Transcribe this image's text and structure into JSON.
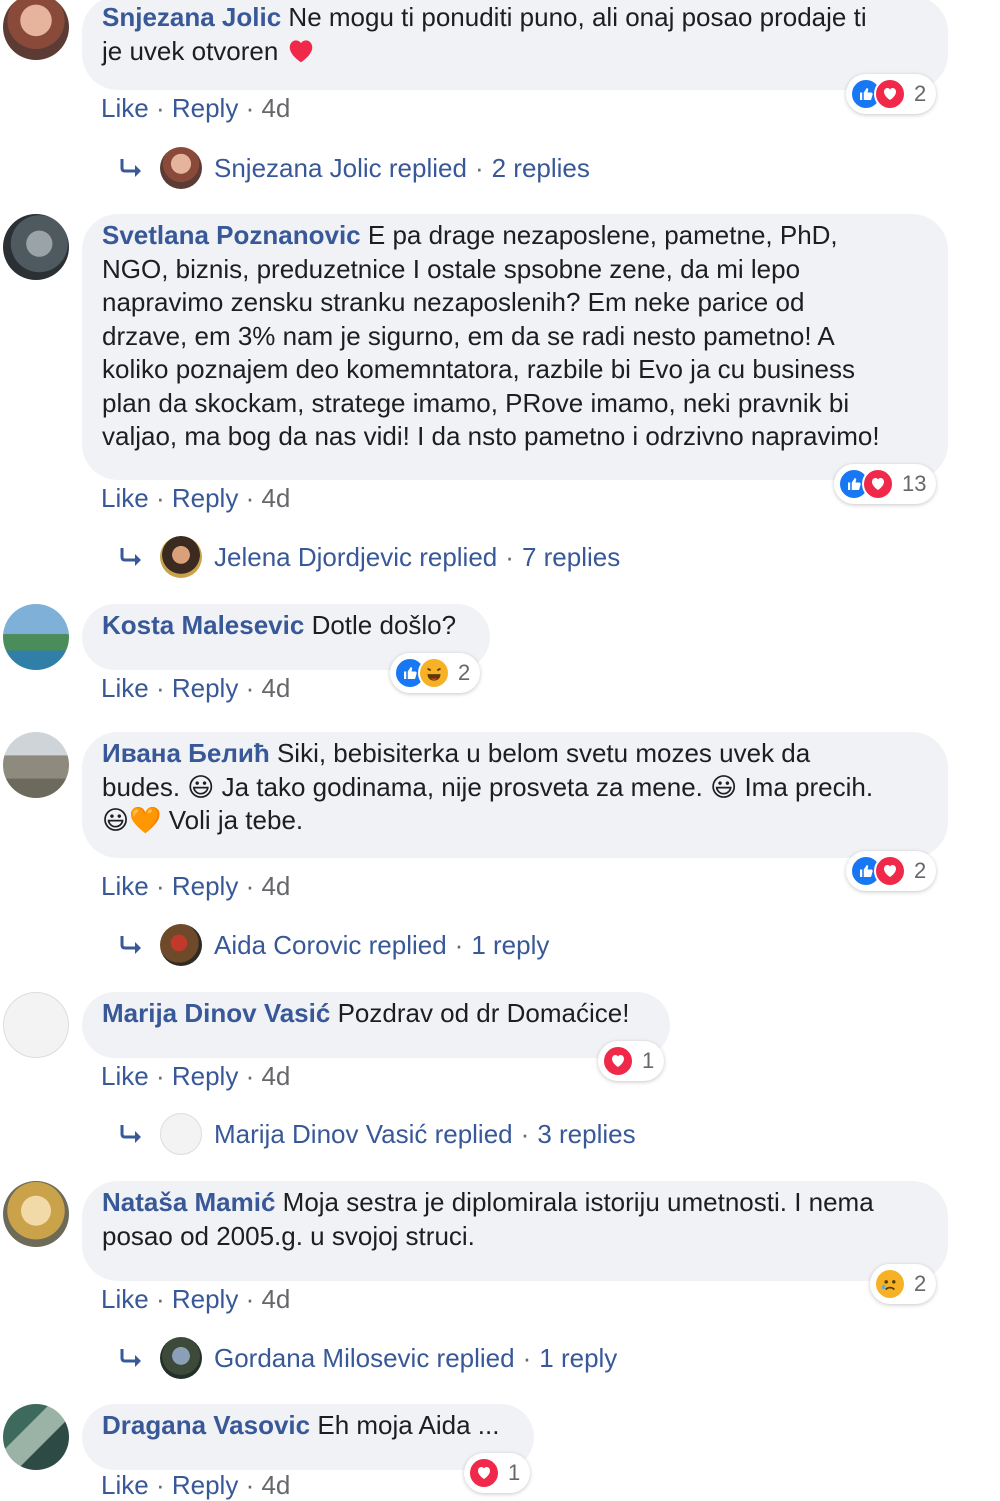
{
  "comments": [
    {
      "author": "Snjezana Jolic",
      "text_lines": [
        "Ne mogu ti ponuditi puno, ali onaj posao prodaje ti",
        "je uvek otvoren"
      ],
      "like_label": "Like",
      "reply_label": "Reply",
      "time": "4d",
      "reactions": [
        "like",
        "love"
      ],
      "reaction_count": "2",
      "thread": {
        "replier": "Snjezana Jolic replied",
        "count": "2 replies"
      }
    },
    {
      "author": "Svetlana Poznanovic",
      "text_lines": [
        "E pa drage nezaposlene, pametne, PhD,",
        "NGO, biznis, preduzetnice I ostale spsobne zene, da mi lepo",
        "napravimo zensku stranku nezaposlenih? Em neke parice od",
        "drzave, em 3% nam je sigurno, em da se radi nesto pametno! A",
        "koliko poznajem deo komemntatora, razbile bi Evo ja cu business",
        "plan da skockam, stratege imamo, PRove imamo, neki pravnik bi",
        "valjao, ma bog da nas vidi! I da nsto pametno i odrzivno napravimo!"
      ],
      "like_label": "Like",
      "reply_label": "Reply",
      "time": "4d",
      "reactions": [
        "like",
        "love"
      ],
      "reaction_count": "13",
      "thread": {
        "replier": "Jelena Djordjevic replied",
        "count": "7 replies"
      }
    },
    {
      "author": "Kosta Malesevic",
      "text_lines": [
        "Dotle došlo?"
      ],
      "like_label": "Like",
      "reply_label": "Reply",
      "time": "4d",
      "reactions": [
        "like",
        "haha"
      ],
      "reaction_count": "2"
    },
    {
      "author": "Ивана Белић",
      "text_lines": [
        "Siki, bebisiterka u belom svetu mozes uvek da",
        "budes. 😃 Ja tako godinama, nije prosveta za mene. 😃 Ima precih.",
        "😃🧡 Voli ja tebe."
      ],
      "like_label": "Like",
      "reply_label": "Reply",
      "time": "4d",
      "reactions": [
        "like",
        "love"
      ],
      "reaction_count": "2",
      "thread": {
        "replier": "Aida Corovic replied",
        "count": "1 reply"
      }
    },
    {
      "author": "Marija Dinov Vasić",
      "text_lines": [
        "Pozdrav od dr Domaćice!"
      ],
      "like_label": "Like",
      "reply_label": "Reply",
      "time": "4d",
      "reactions": [
        "love"
      ],
      "reaction_count": "1",
      "thread": {
        "replier": "Marija Dinov Vasić replied",
        "count": "3 replies"
      }
    },
    {
      "author": "Nataša Mamić",
      "text_lines": [
        "Moja sestra je diplomirala istoriju umetnosti. I nema",
        "posao od 2005.g. u svojoj struci."
      ],
      "like_label": "Like",
      "reply_label": "Reply",
      "time": "4d",
      "reactions": [
        "sad"
      ],
      "reaction_count": "2",
      "thread": {
        "replier": "Gordana Milosevic replied",
        "count": "1 reply"
      }
    },
    {
      "author": "Dragana Vasovic",
      "text_lines": [
        "Eh moja Aida ..."
      ],
      "like_label": "Like",
      "reply_label": "Reply",
      "time": "4d",
      "reactions": [
        "love"
      ],
      "reaction_count": "1"
    }
  ],
  "separator": "·",
  "colors": {
    "name": "#385898",
    "bubble": "#f0f2f5",
    "meta": "#65676b",
    "like": "#1877f2",
    "love": "#f02849",
    "emoji": "#f7b125"
  }
}
